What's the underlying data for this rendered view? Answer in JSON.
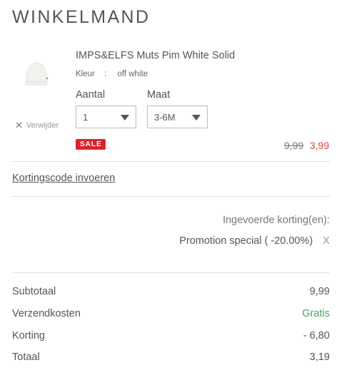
{
  "cart": {
    "title": "WINKELMAND"
  },
  "item": {
    "name": "IMPS&ELFS Muts Pim White Solid",
    "color_label": "Kleur",
    "color_sep": ":",
    "color_value": "off white",
    "image_icon": "beanie-hat-icon",
    "remove_label": "Verwijder",
    "remove_icon": "close-icon",
    "quantity_label": "Aantal",
    "quantity_value": "1",
    "size_label": "Maat",
    "size_value": "3-6M",
    "sale_badge": "SALE",
    "old_price": "9,99",
    "new_price": "3,99"
  },
  "discount": {
    "link_label": "Kortingscode invoeren",
    "applied_title": "Ingevoerde korting(en):",
    "promo_label": "Promotion special ( -20.00%)",
    "promo_remove": "X"
  },
  "summary": {
    "subtotal_label": "Subtotaal",
    "subtotal_value": "9,99",
    "shipping_label": "Verzendkosten",
    "shipping_value": "Gratis",
    "discount_label": "Korting",
    "discount_value": "- 6,80",
    "total_label": "Totaal",
    "total_value": "3,19"
  },
  "colors": {
    "sale_red": "#d9252b",
    "price_red": "#e0443e",
    "free_green": "#3caa5a"
  }
}
